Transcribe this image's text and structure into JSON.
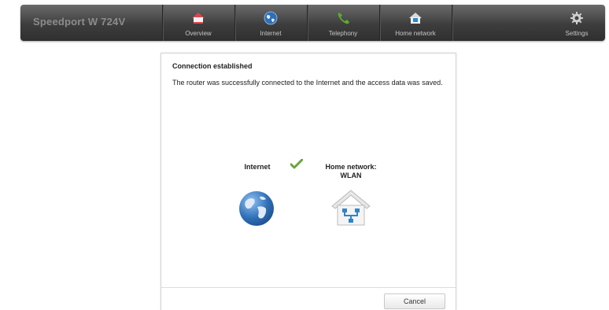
{
  "header": {
    "brand": "Speedport W 724V",
    "nav": [
      {
        "label": "Overview",
        "icon": "house-icon"
      },
      {
        "label": "Internet",
        "icon": "globe-icon"
      },
      {
        "label": "Telephony",
        "icon": "phone-icon"
      },
      {
        "label": "Home network",
        "icon": "home-network-icon"
      }
    ],
    "settings_label": "Settings"
  },
  "dialog": {
    "title": "Connection established",
    "message": "The router was successfully connected to the Internet and the access data was saved.",
    "internet_label": "Internet",
    "home_network_label_line1": "Home network:",
    "home_network_label_line2": "WLAN",
    "cancel_label": "Cancel"
  },
  "colors": {
    "topbar": "#3d3d3d",
    "overview_icon": "#e0444e",
    "internet_icon": "#2f6fb7",
    "telephony_icon": "#5bab2e",
    "checkmark": "#6aa63c",
    "network_icon": "#2c86c9"
  }
}
